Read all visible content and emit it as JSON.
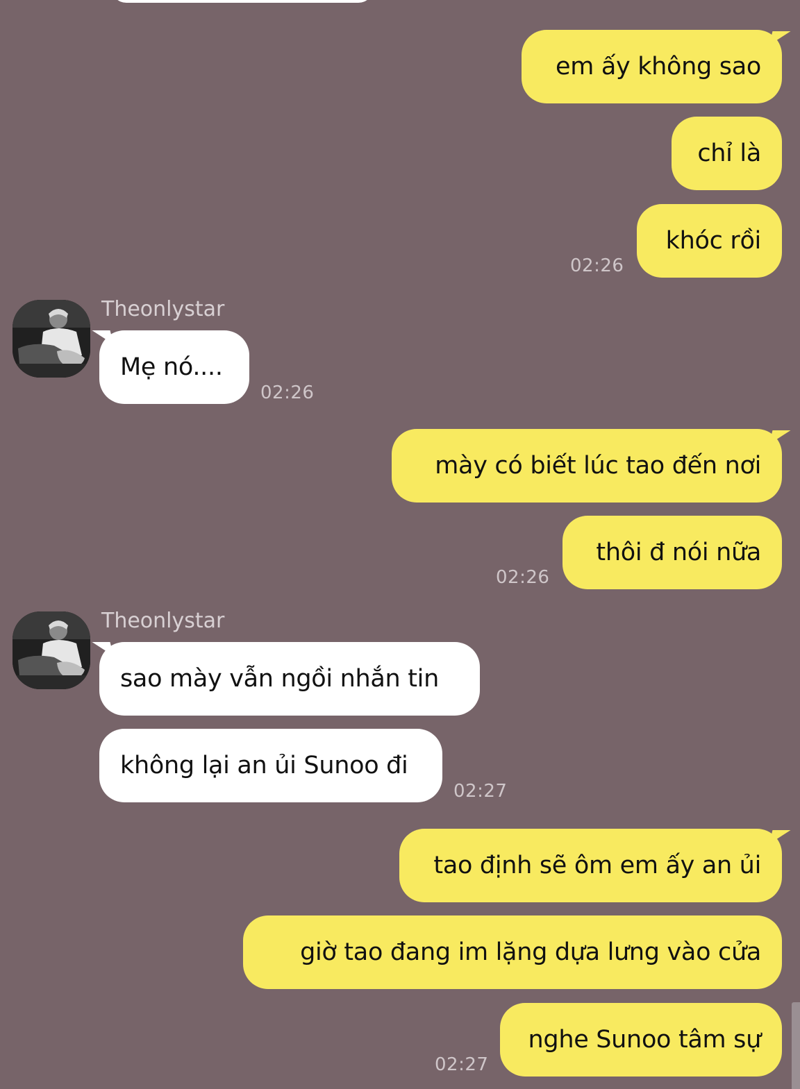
{
  "conversation": {
    "messages": [
      {
        "id": 1,
        "side": "me",
        "text": "em ấy không sao"
      },
      {
        "id": 2,
        "side": "me",
        "text": "chỉ là"
      },
      {
        "id": 3,
        "side": "me",
        "text": "khóc rồi",
        "time": "02:26"
      },
      {
        "id": 4,
        "side": "them",
        "sender": "Theonlystar",
        "text": "Mẹ nó....",
        "time": "02:26"
      },
      {
        "id": 5,
        "side": "me",
        "text": "mày có biết lúc tao đến nơi"
      },
      {
        "id": 6,
        "side": "me",
        "text": "thôi đ nói nữa",
        "time": "02:26"
      },
      {
        "id": 7,
        "side": "them",
        "sender": "Theonlystar",
        "text": "sao mày vẫn ngồi nhắn tin"
      },
      {
        "id": 8,
        "side": "them",
        "text": "không lại an ủi Sunoo đi",
        "time": "02:27"
      },
      {
        "id": 9,
        "side": "me",
        "text": "tao định sẽ ôm em ấy an ủi"
      },
      {
        "id": 10,
        "side": "me",
        "text": "giờ tao đang im lặng dựa lưng vào cửa"
      },
      {
        "id": 11,
        "side": "me",
        "text": "nghe Sunoo tâm sự",
        "time": "02:27"
      }
    ]
  },
  "colors": {
    "background": "#776469",
    "my_bubble": "#f8ea60",
    "their_bubble": "#ffffff",
    "timestamp": "#cfc6c9",
    "sender_name": "#d8d0d3"
  },
  "icons": {
    "avatar": "profile-photo-person-with-guitar"
  }
}
